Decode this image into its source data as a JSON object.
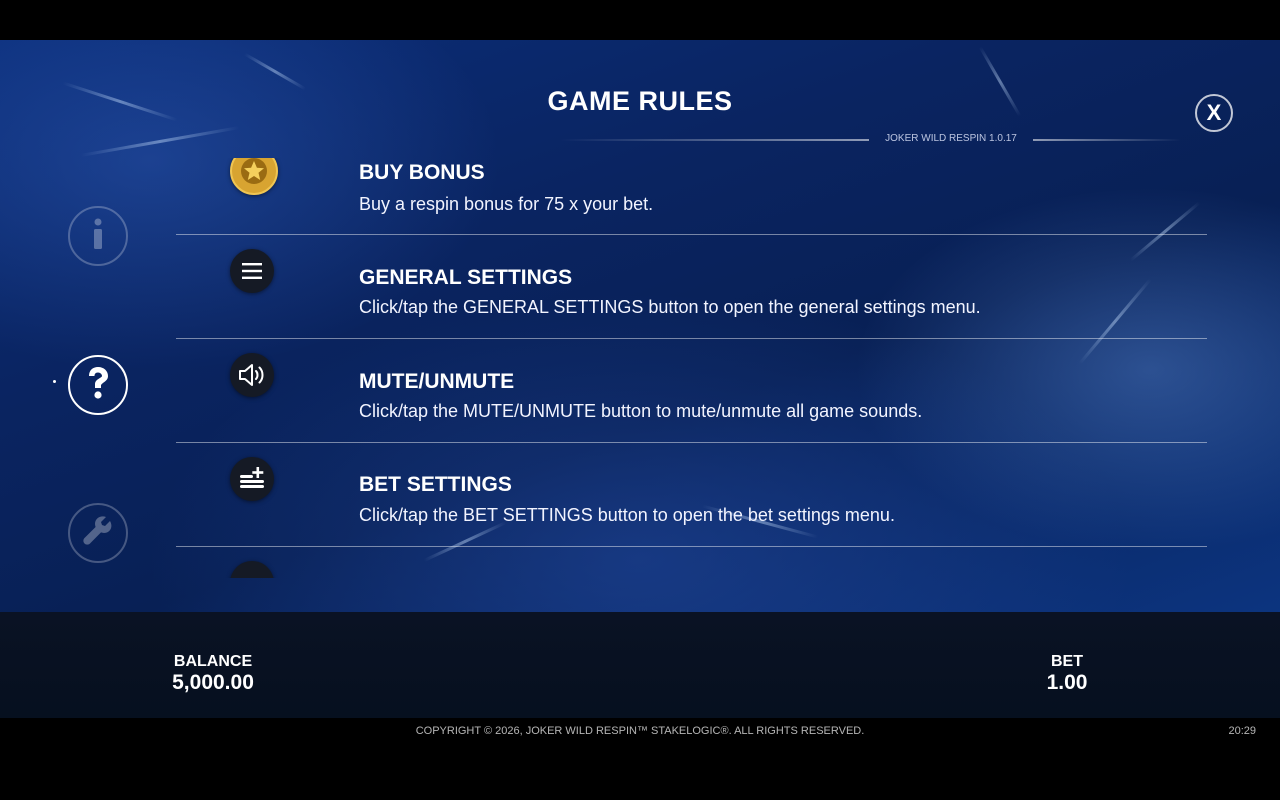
{
  "header": {
    "title": "GAME RULES",
    "version": "JOKER WILD RESPIN 1.0.17",
    "close_label": "X"
  },
  "sidebar": {
    "items": [
      {
        "name": "info",
        "icon": "info-icon",
        "active": false
      },
      {
        "name": "help",
        "icon": "question-icon",
        "active": true
      },
      {
        "name": "settings",
        "icon": "wrench-icon",
        "active": false
      }
    ]
  },
  "rules": [
    {
      "icon": "star-coin-icon",
      "title": "BUY BONUS",
      "description": "Buy a respin bonus for 75 x your bet."
    },
    {
      "icon": "menu-icon",
      "title": "GENERAL SETTINGS",
      "description": "Click/tap the GENERAL SETTINGS button to open the general settings menu."
    },
    {
      "icon": "speaker-icon",
      "title": "MUTE/UNMUTE",
      "description": "Click/tap the MUTE/UNMUTE button to mute/unmute all game sounds."
    },
    {
      "icon": "coins-plus-icon",
      "title": "BET SETTINGS",
      "description": "Click/tap the BET SETTINGS button to open the bet settings menu."
    }
  ],
  "status_bar": {
    "balance_label": "BALANCE",
    "balance_value": "5,000.00",
    "bet_label": "BET",
    "bet_value": "1.00"
  },
  "footer": {
    "copyright": "COPYRIGHT © 2026, JOKER WILD RESPIN™ STAKELOGIC®. ALL RIGHTS RESERVED.",
    "time": "20:29"
  },
  "colors": {
    "background": "#0a2461",
    "coin_gold": "#d8a431",
    "text": "#ffffff"
  }
}
